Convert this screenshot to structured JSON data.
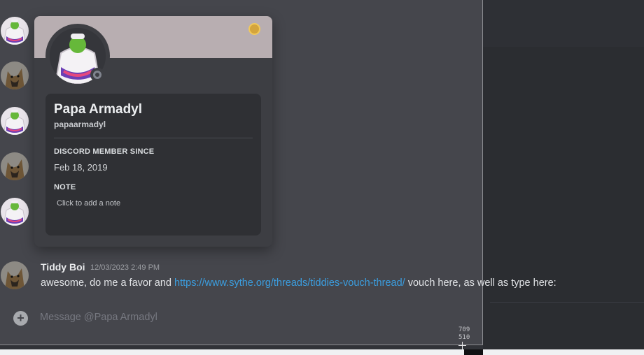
{
  "profile": {
    "display_name": "Papa Armadyl",
    "username": "papaarmadyl",
    "member_since_title": "DISCORD MEMBER SINCE",
    "member_since_value": "Feb 18, 2019",
    "note_title": "NOTE",
    "note_placeholder": "Click to add a note",
    "banner_color": "#b8aeb1",
    "status": "offline"
  },
  "message": {
    "author": "Tiddy Boi",
    "timestamp": "12/03/2023 2:49 PM",
    "text_before": "awesome, do me a favor and ",
    "link": "https://www.sythe.org/threads/tiddies-vouch-thread/",
    "text_after": " vouch here, as well as type here:"
  },
  "composer": {
    "placeholder": "Message @Papa Armadyl",
    "add_icon": "plus-circle-icon"
  },
  "selection_readout": {
    "width": "709",
    "height": "510"
  },
  "colors": {
    "link": "#3b9ee0",
    "app_bg": "#313338",
    "overlay_bg": "#45464c"
  }
}
